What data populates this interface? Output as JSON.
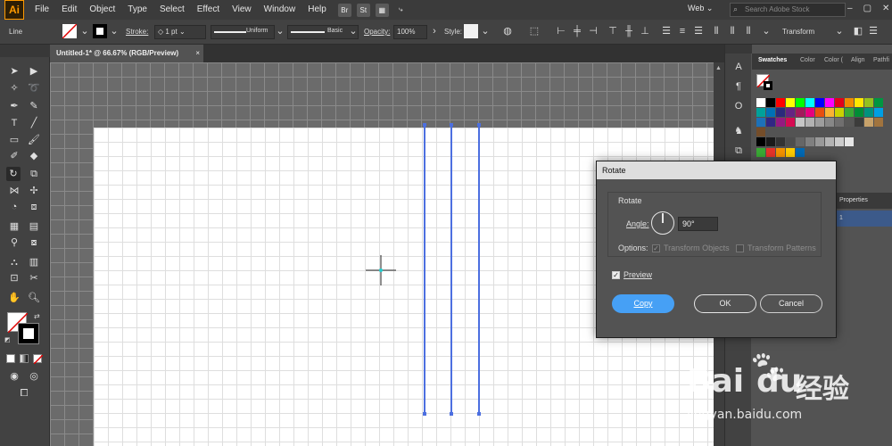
{
  "app": {
    "logo": "Ai"
  },
  "menu": [
    "File",
    "Edit",
    "Object",
    "Type",
    "Select",
    "Effect",
    "View",
    "Window",
    "Help"
  ],
  "app_badges": [
    "Br",
    "St"
  ],
  "workspace": "Web",
  "search_placeholder": "Search Adobe Stock",
  "control_bar": {
    "object_type": "Line",
    "stroke_label": "Stroke:",
    "stroke_weight": "1 pt",
    "uniform_label": "Uniform",
    "basic_label": "Basic",
    "opacity_label": "Opacity:",
    "opacity_value": "100%",
    "style_label": "Style:",
    "transform_label": "Transform"
  },
  "document": {
    "tab_title": "Untitled-1* @ 66.67% (RGB/Preview)",
    "close": "×"
  },
  "swatches_panel": {
    "tabs": [
      "Swatches",
      "Color",
      "Color (",
      "Align",
      "Pathfi"
    ],
    "properties_label": "Properties",
    "layer_number": "1",
    "colors": [
      "#ffffff",
      "#000000",
      "#ff0000",
      "#ffff00",
      "#00ff00",
      "#00ffff",
      "#0000ff",
      "#ff00ff",
      "#e3001b",
      "#f08a00",
      "#ffe600",
      "#95c11f",
      "#009640",
      "#00a19a",
      "#0071b6",
      "#2b2a7c",
      "#662483",
      "#a3195b",
      "#e6007e",
      "#e84e0f",
      "#f9b233",
      "#c9d200",
      "#3aaa35",
      "#008d36",
      "#00927d",
      "#009fe3",
      "#1d71b8",
      "#312783",
      "#951b81",
      "#d60b52",
      "#c6c6c6",
      "#b2b2b2",
      "#9d9d9d",
      "#878787",
      "#706f6f",
      "#575756",
      "#3c3c3b",
      "#c7a26a",
      "#a1743e",
      "#744d2a"
    ],
    "grays": [
      "#000000",
      "#1a1a1a",
      "#333333",
      "#4d4d4d",
      "#666666",
      "#808080",
      "#999999",
      "#b3b3b3",
      "#cccccc",
      "#e6e6e6"
    ],
    "groups": [
      "#3aaa35",
      "#e6332a",
      "#f39200",
      "#ffcc00",
      "#0069b4"
    ]
  },
  "dialog": {
    "title": "Rotate",
    "section": "Rotate",
    "angle_label": "Angle:",
    "angle_value": "90°",
    "options_label": "Options:",
    "transform_objects": "Transform Objects",
    "transform_patterns": "Transform Patterns",
    "preview_label": "Preview",
    "copy_button": "Copy",
    "ok_button": "OK",
    "cancel_button": "Cancel"
  },
  "watermark": {
    "brand": "Bai",
    "brand2": "du",
    "cn": "经验",
    "url": "jingyan.baidu.com"
  },
  "colors": {
    "accent": "#46a0f5",
    "selection": "#4c6fe0",
    "ai_orange": "#ff9a00"
  }
}
